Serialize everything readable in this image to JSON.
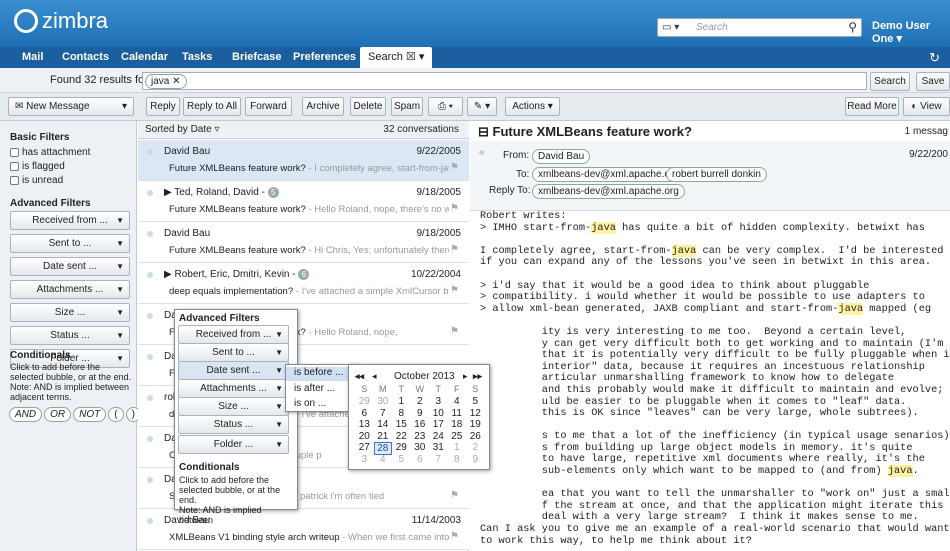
{
  "app": {
    "brand": "zimbra",
    "search_placeholder": "Search",
    "user": "Demo User One"
  },
  "nav": [
    "Mail",
    "Contacts",
    "Calendar",
    "Tasks",
    "Briefcase",
    "Preferences",
    "Search"
  ],
  "results": {
    "found": "Found 32 results for:",
    "query": "java",
    "search_btn": "Search",
    "save_btn": "Save"
  },
  "toolbar": {
    "new_message": "New Message",
    "reply": "Reply",
    "reply_all": "Reply to All",
    "forward": "Forward",
    "archive": "Archive",
    "delete": "Delete",
    "spam": "Spam",
    "actions": "Actions",
    "read_more": "Read More",
    "view": "View"
  },
  "filters": {
    "basic_title": "Basic Filters",
    "basic": [
      "has attachment",
      "is flagged",
      "is unread"
    ],
    "adv_title": "Advanced Filters",
    "adv": [
      "Received from ...",
      "Sent to ...",
      "Date sent ...",
      "Attachments ...",
      "Size ...",
      "Status ...",
      "Folder ..."
    ],
    "cond_title": "Conditionals",
    "cond_text": [
      "Click to add before the",
      "selected bubble, or at the end.",
      "Note: AND is implied between",
      "adjacent terms."
    ],
    "cond_ops": [
      "AND",
      "OR",
      "NOT",
      "(",
      ")"
    ]
  },
  "list": {
    "sort": "Sorted by Date",
    "count": "32 conversations",
    "rows": [
      {
        "from": "David Bau",
        "date": "9/22/2005",
        "subject": "Future XMLBeans feature work?",
        "frag": " - I completely agree, start-from-java car",
        "sel": true
      },
      {
        "from": "Ted, Roland, David",
        "badge": "5",
        "date": "9/18/2005",
        "subject": "Future XMLBeans feature work?",
        "frag": " - Hello Roland, nope, there's no way of r"
      },
      {
        "from": "David Bau",
        "date": "9/18/2005",
        "subject": "Future XMLBeans feature work?",
        "frag": " - Hi Chris, Yes; unfortunately there is no"
      },
      {
        "from": "Robert, Eric, Dmitri, Kevin",
        "badge": "6",
        "date": "10/22/2004",
        "subject": "deep equals implementation?",
        "frag": " - I've attached a simple XmlCursor ba"
      },
      {
        "from": "David Bau",
        "date": "",
        "subject": "Future XMLBeans feature work?",
        "frag": " - Hello Roland, nope,"
      },
      {
        "from": "David Bau",
        "date": "",
        "subject": "Future XMLBeans feature work?",
        "frag": " - Hi Chris, Yes; unfort"
      },
      {
        "from": "robert burrell donkin",
        "date": "",
        "subject": "deep equals implementation?",
        "frag": " - I've attached a simple"
      },
      {
        "from": "David Bau",
        "date": "",
        "subject": "Contributing XMLBeans",
        "frag": " - a couple p"
      },
      {
        "from": "David Bau",
        "date": "",
        "subject": "Start-with-java annotations",
        "frag": " - hi patrick i'm often tied"
      },
      {
        "from": "David Bau",
        "date": "11/14/2003",
        "subject": "XMLBeans V1 binding style arch writeup",
        "frag": " - When we first came into the ir"
      }
    ]
  },
  "reading": {
    "subject": "Future XMLBeans feature work?",
    "count": "1 messag",
    "from_label": "From:",
    "from": "David Bau",
    "to_label": "To:",
    "to": [
      "xmlbeans-dev@xml.apache.org",
      "robert burrell donkin"
    ],
    "replyto_label": "Reply To:",
    "replyto": "xmlbeans-dev@xml.apache.org",
    "date": "9/22/200"
  },
  "popup": {
    "title": "Advanced Filters",
    "items": [
      "Received from ...",
      "Sent to ...",
      "Date sent ...",
      "Attachments ...",
      "Size ...",
      "Status ...",
      "Folder ..."
    ],
    "cond_title": "Conditionals",
    "cond_text": [
      "Click to add before the",
      "selected bubble, or at the end.",
      "Note: AND is implied between"
    ]
  },
  "datemenu": [
    "is before ...",
    "is after ...",
    "is on ..."
  ],
  "calendar": {
    "month": "October 2013",
    "days": [
      "S",
      "M",
      "T",
      "W",
      "T",
      "F",
      "S"
    ],
    "weeks": [
      [
        "29",
        "30",
        "1",
        "2",
        "3",
        "4",
        "5"
      ],
      [
        "6",
        "7",
        "8",
        "9",
        "10",
        "11",
        "12"
      ],
      [
        "13",
        "14",
        "15",
        "16",
        "17",
        "18",
        "19"
      ],
      [
        "20",
        "21",
        "22",
        "23",
        "24",
        "25",
        "26"
      ],
      [
        "27",
        "28",
        "29",
        "30",
        "31",
        "1",
        "2"
      ],
      [
        "3",
        "4",
        "5",
        "6",
        "7",
        "8",
        "9"
      ]
    ],
    "selected": "28"
  }
}
